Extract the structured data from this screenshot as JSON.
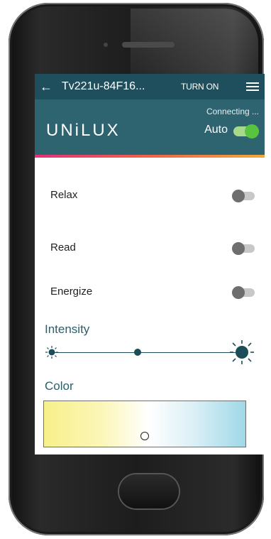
{
  "appbar": {
    "back_icon": "back-arrow-icon",
    "back_glyph": "←",
    "title": "Tv221u-84F16...",
    "turn_on_label": "TURN ON",
    "menu_icon": "hamburger-menu-icon"
  },
  "brand": {
    "logo_text": "UNiLUX",
    "status": "Connecting ...",
    "auto_label": "Auto",
    "auto_enabled": true
  },
  "modes": [
    {
      "label": "Relax",
      "enabled": false
    },
    {
      "label": "Read",
      "enabled": false
    },
    {
      "label": "Energize",
      "enabled": false
    }
  ],
  "intensity": {
    "label": "Intensity",
    "value_fraction": 0.45
  },
  "color": {
    "label": "Color",
    "gradient": [
      "#f8f08a",
      "#ffffff",
      "#9fd8e8"
    ]
  },
  "colors": {
    "appbar": "#1f4f5c",
    "brandbar": "#2e6370",
    "accent_gradient": [
      "#e4307a",
      "#ef6a46",
      "#f2a83c"
    ],
    "auto_toggle_on": "#57c33f",
    "toggle_off": "#6e6e6e"
  }
}
